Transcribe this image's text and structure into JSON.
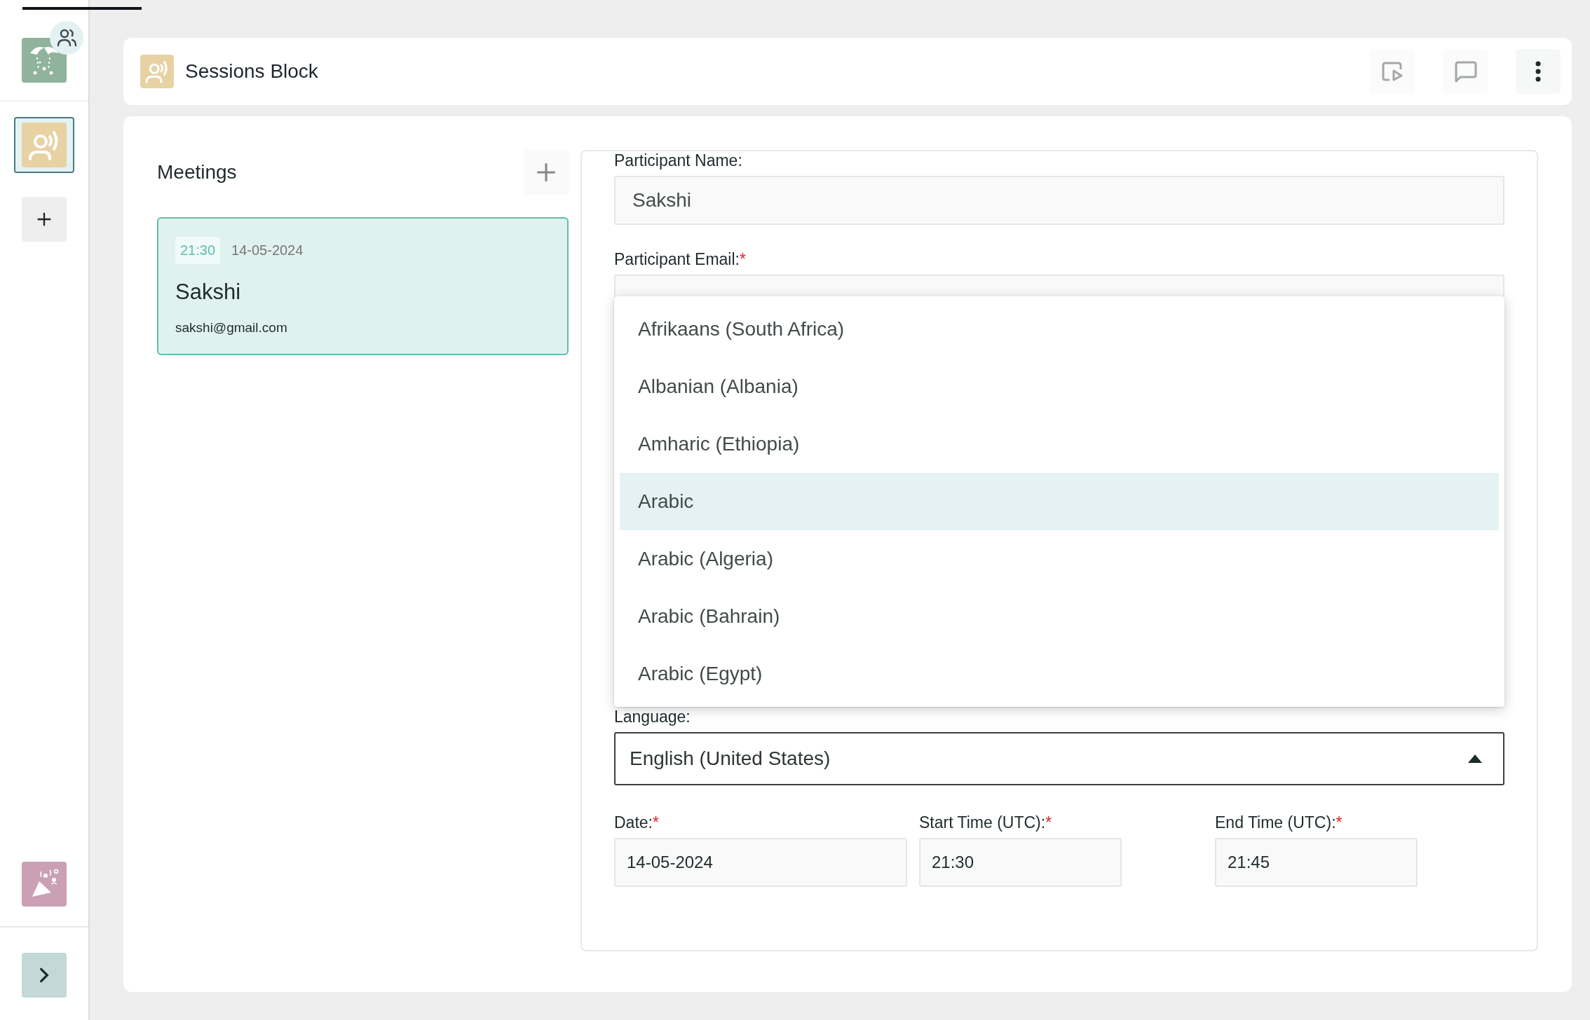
{
  "sidebar": {
    "apps": [
      {
        "kind": "fireworks",
        "selected": false,
        "badge": true
      },
      {
        "kind": "sessions",
        "selected": true,
        "badge": false
      }
    ],
    "bottom_apps": [
      {
        "kind": "party",
        "selected": false,
        "badge": false
      }
    ]
  },
  "header": {
    "title": "Sessions Block"
  },
  "meetings": {
    "title": "Meetings",
    "items": [
      {
        "time": "21:30",
        "date": "14-05-2024",
        "name": "Sakshi",
        "email": "sakshi@gmail.com",
        "selected": true
      }
    ]
  },
  "form": {
    "required_mark": "*",
    "fields": [
      {
        "label": "Participant Name:",
        "required": false,
        "value": "Sakshi"
      },
      {
        "label": "Participant Email:",
        "required": true
      }
    ],
    "language": {
      "label": "Language:",
      "required": false,
      "value": "English (United States)",
      "expanded": true,
      "options": [
        {
          "label": "Afrikaans (South Africa)",
          "selected": false
        },
        {
          "label": "Albanian (Albania)",
          "selected": false
        },
        {
          "label": "Amharic (Ethiopia)",
          "selected": false
        },
        {
          "label": "Arabic",
          "selected": true
        },
        {
          "label": "Arabic (Algeria)",
          "selected": false
        },
        {
          "label": "Arabic (Bahrain)",
          "selected": false
        },
        {
          "label": "Arabic (Egypt)",
          "selected": false
        }
      ]
    },
    "schedule": [
      {
        "label": "Date:",
        "required": true,
        "value": "14-05-2024"
      },
      {
        "label": "Start Time (UTC):",
        "required": true,
        "value": "21:30"
      },
      {
        "label": "End Time (UTC):",
        "required": true,
        "value": "21:45"
      }
    ]
  }
}
